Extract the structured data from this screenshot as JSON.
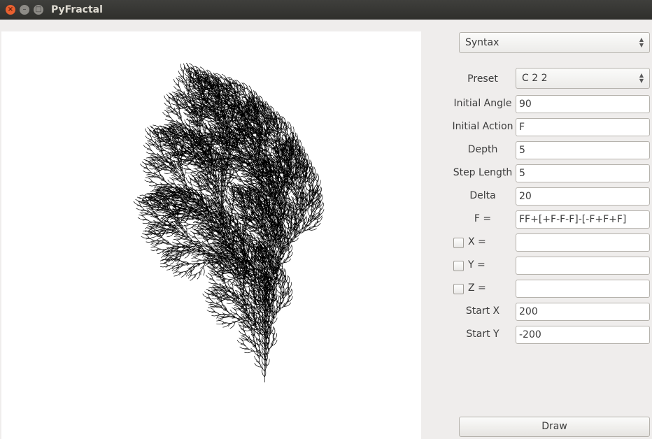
{
  "window": {
    "title": "PyFractal"
  },
  "controls": {
    "mode_combo": "Syntax",
    "preset_label": "Preset",
    "preset_value": "C 2 2",
    "initial_angle_label": "Initial Angle",
    "initial_angle_value": "90",
    "initial_action_label": "Initial Action",
    "initial_action_value": "F",
    "depth_label": "Depth",
    "depth_value": "5",
    "step_length_label": "Step Length",
    "step_length_value": "5",
    "delta_label": "Delta",
    "delta_value": "20",
    "f_rule_label": "F =",
    "f_rule_value": "FF+[+F-F-F]-[-F+F+F]",
    "x_rule_label": "X =",
    "x_rule_value": "",
    "x_rule_enabled": false,
    "y_rule_label": "Y =",
    "y_rule_value": "",
    "y_rule_enabled": false,
    "z_rule_label": "Z =",
    "z_rule_value": "",
    "z_rule_enabled": false,
    "start_x_label": "Start X",
    "start_x_value": "200",
    "start_y_label": "Start Y",
    "start_y_value": "-200",
    "draw_button": "Draw"
  },
  "icons": {
    "close": "close-icon",
    "minimize": "minimize-icon",
    "maximize": "maximize-icon",
    "combo_arrows": "updown-arrows-icon"
  },
  "colors": {
    "titlebar": "#3c3b37",
    "close_button": "#e9602f",
    "window_bg": "#efedec",
    "canvas_bg": "#ffffff",
    "fractal_stroke": "#000000"
  }
}
